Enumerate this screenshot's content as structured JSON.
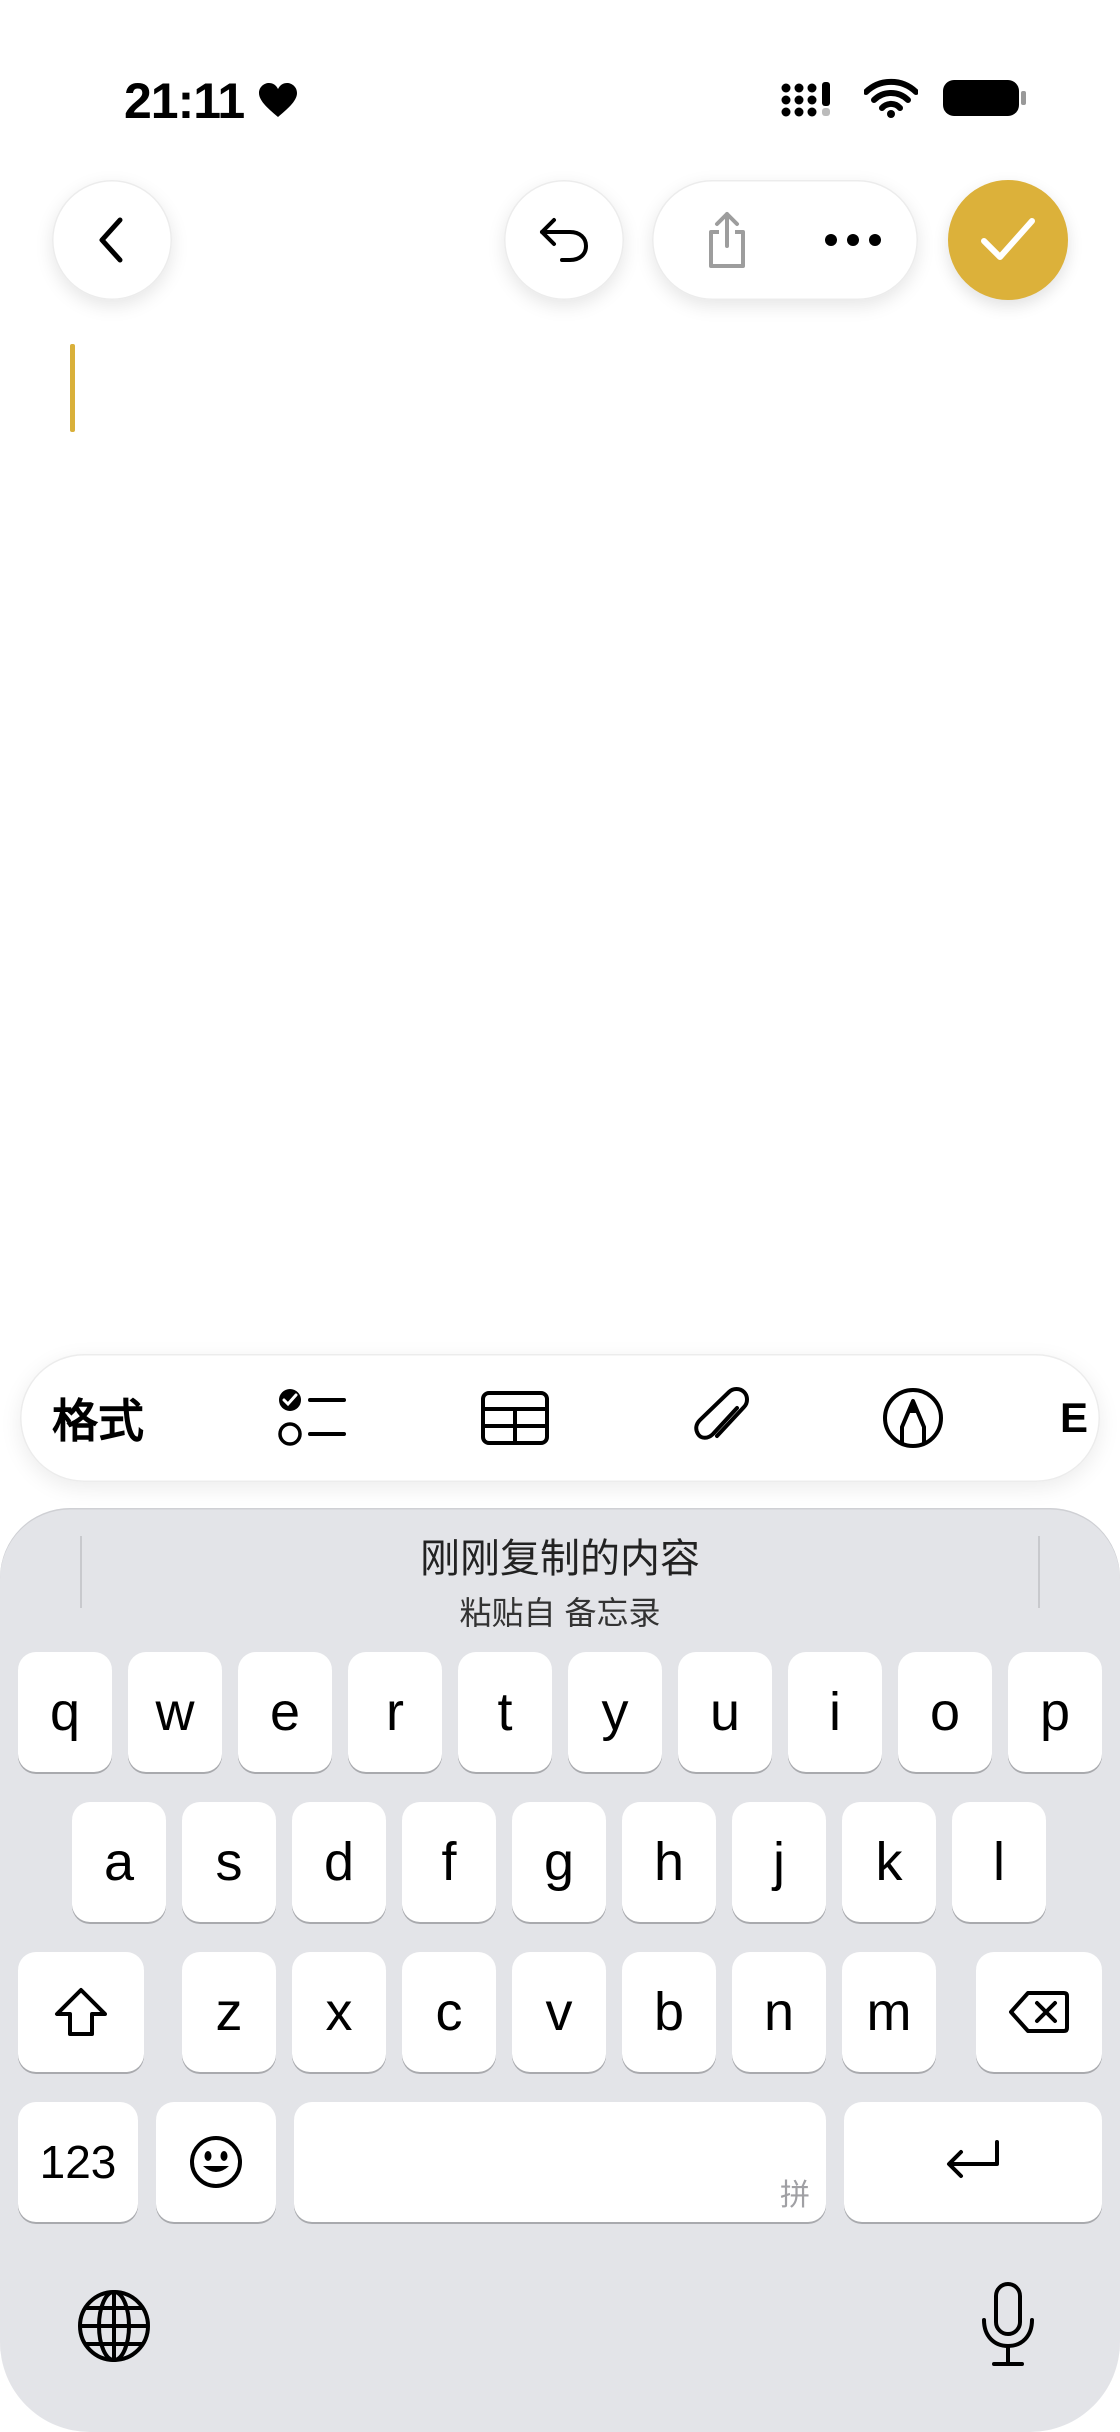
{
  "status_bar": {
    "time": "21:11"
  },
  "clipboard_suggestion": {
    "title": "刚刚复制的内容",
    "subtitle": "粘贴自 备忘录"
  },
  "toolbar": {
    "format_label": "格式"
  },
  "keyboard": {
    "row1": [
      "q",
      "w",
      "e",
      "r",
      "t",
      "y",
      "u",
      "i",
      "o",
      "p"
    ],
    "row2": [
      "a",
      "s",
      "d",
      "f",
      "g",
      "h",
      "j",
      "k",
      "l"
    ],
    "row3": [
      "z",
      "x",
      "c",
      "v",
      "b",
      "n",
      "m"
    ],
    "numbers_label": "123",
    "space_hint": "拼"
  },
  "colors": {
    "accent": "#dcb13a",
    "keyboard_bg": "#e3e4e8"
  }
}
